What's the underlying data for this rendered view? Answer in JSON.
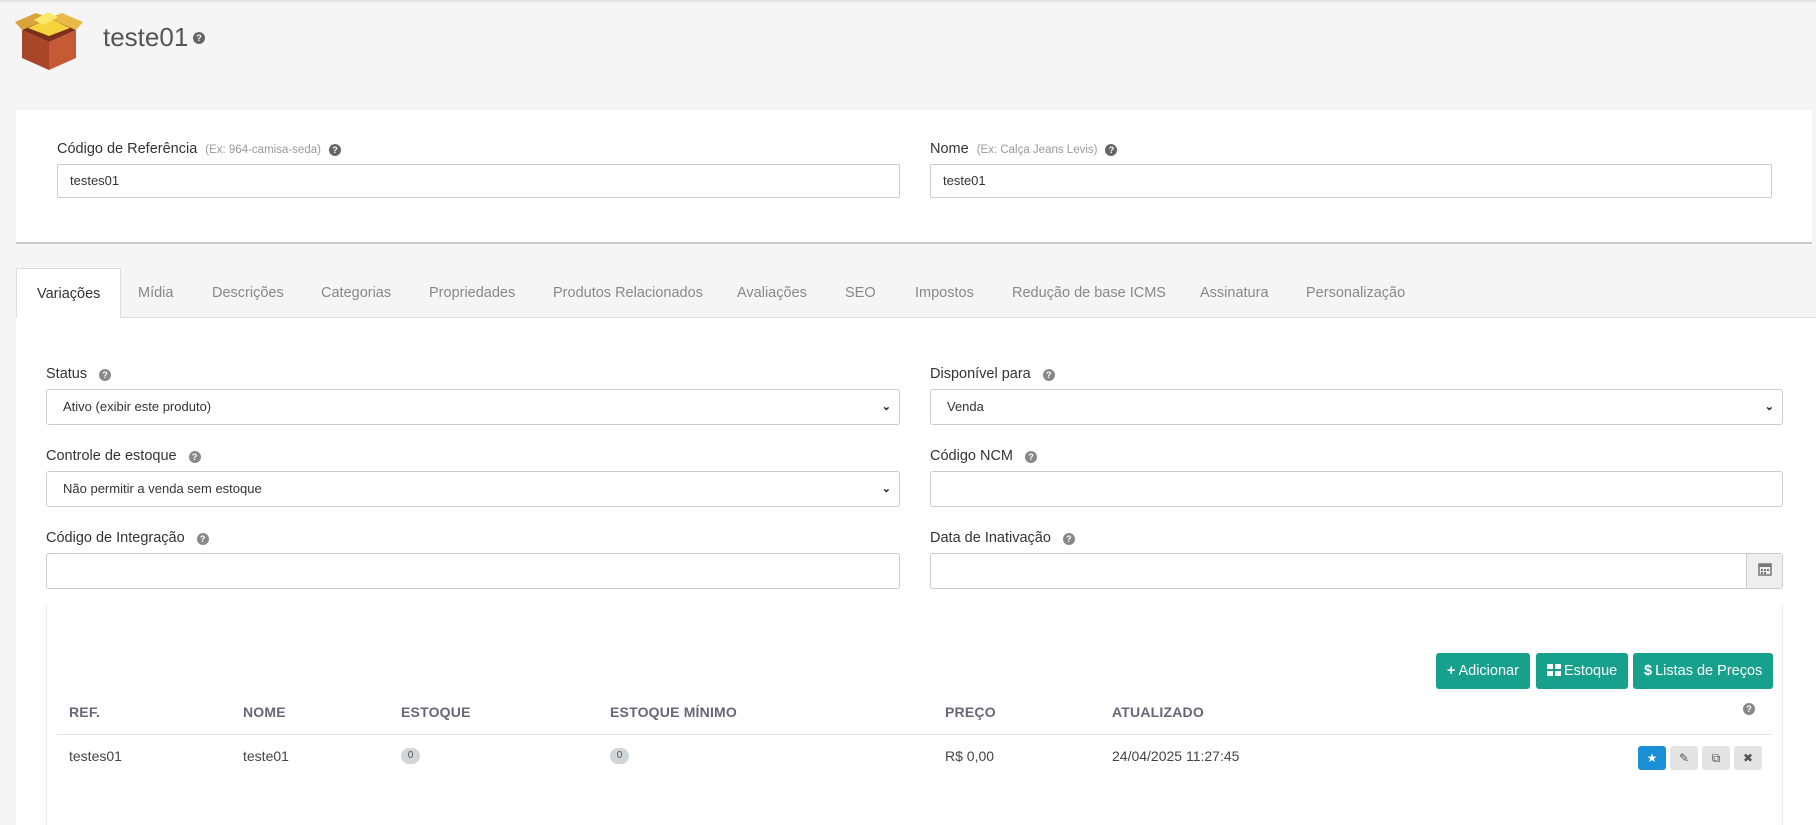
{
  "header": {
    "title": "teste01"
  },
  "product": {
    "ref_label": "Código de Referência",
    "ref_hint": "(Ex: 964-camisa-seda)",
    "ref_value": "testes01",
    "name_label": "Nome",
    "name_hint": "(Ex: Calça Jeans Levis)",
    "name_value": "teste01"
  },
  "tabs": [
    "Variações",
    "Mídia",
    "Descrições",
    "Categorias",
    "Propriedades",
    "Produtos Relacionados",
    "Avaliações",
    "SEO",
    "Impostos",
    "Redução de base ICMS",
    "Assinatura",
    "Personalização"
  ],
  "form": {
    "status_label": "Status",
    "status_value": "Ativo (exibir este produto)",
    "disponivel_label": "Disponível para",
    "disponivel_value": "Venda",
    "estoque_label": "Controle de estoque",
    "estoque_value": "Não permitir a venda sem estoque",
    "ncm_label": "Código NCM",
    "ncm_value": "",
    "integracao_label": "Código de Integração",
    "integracao_value": "",
    "inativacao_label": "Data de Inativação",
    "inativacao_value": ""
  },
  "buttons": {
    "adicionar": "Adicionar",
    "estoque": "Estoque",
    "listas": "Listas de Preços"
  },
  "table": {
    "headers": [
      "REF.",
      "NOME",
      "ESTOQUE",
      "ESTOQUE MÍNIMO",
      "PREÇO",
      "ATUALIZADO"
    ],
    "rows": [
      {
        "ref": "testes01",
        "nome": "teste01",
        "estoque": "0",
        "estoque_minimo": "0",
        "preco": "R$ 0,00",
        "atualizado": "24/04/2025 11:27:45"
      }
    ]
  },
  "icons": {
    "logo": "product-box-logo",
    "help": "question-circle-icon",
    "calendar": "calendar-icon",
    "plus": "plus-icon",
    "grid": "th-large-icon",
    "dollar": "dollar-icon",
    "star": "star-icon",
    "pencil": "pencil-icon",
    "copy": "copy-icon",
    "remove": "times-icon"
  },
  "colors": {
    "accent_green": "#17a08c",
    "primary_blue": "#1a8fd6"
  }
}
